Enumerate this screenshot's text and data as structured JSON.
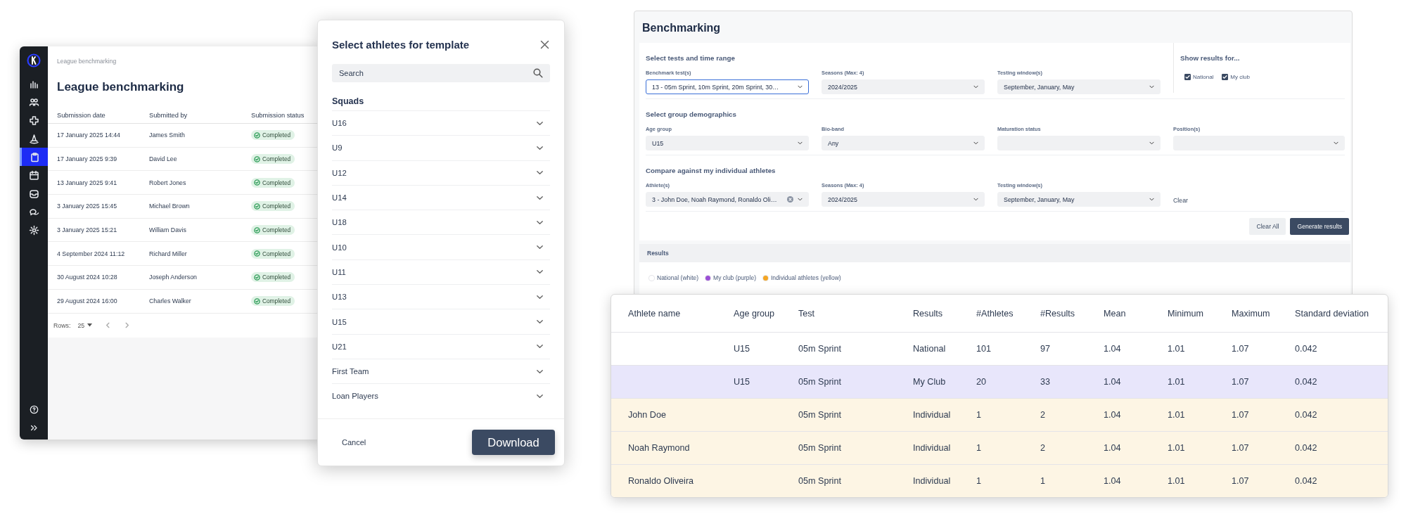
{
  "league_app": {
    "sidebar": {
      "items": [
        {
          "selected": false
        },
        {
          "selected": false
        },
        {
          "selected": false
        },
        {
          "selected": false
        },
        {
          "selected": true
        },
        {
          "selected": false
        },
        {
          "selected": false
        },
        {
          "selected": false
        },
        {
          "selected": false
        }
      ]
    },
    "breadcrumb": "League benchmarking",
    "title": "League benchmarking",
    "table": {
      "columns": [
        "Submission date",
        "Submitted by",
        "Submission status"
      ],
      "rows": [
        {
          "date": "17 January 2025 14:44",
          "by": "James Smith",
          "status": "Completed"
        },
        {
          "date": "17 January 2025 9:39",
          "by": "David Lee",
          "status": "Completed"
        },
        {
          "date": "13 January 2025 9:41",
          "by": "Robert Jones",
          "status": "Completed"
        },
        {
          "date": "3 January 2025 15:45",
          "by": "Michael Brown",
          "status": "Completed"
        },
        {
          "date": "3 January 2025 15:21",
          "by": "William Davis",
          "status": "Completed"
        },
        {
          "date": "4 September 2024 11:12",
          "by": "Richard Miller",
          "status": "Completed"
        },
        {
          "date": "30 August 2024 10:28",
          "by": "Joseph Anderson",
          "status": "Completed"
        },
        {
          "date": "29 August 2024 16:00",
          "by": "Charles Walker",
          "status": "Completed"
        }
      ]
    },
    "footer": {
      "rows_label": "Rows:",
      "rows_value": "25"
    }
  },
  "template_dialog": {
    "title": "Select athletes for template",
    "search": {
      "placeholder": "Search"
    },
    "section": "Squads",
    "squads": [
      {
        "label": "U16"
      },
      {
        "label": "U9"
      },
      {
        "label": "U12"
      },
      {
        "label": "U14"
      },
      {
        "label": "U18"
      },
      {
        "label": "U10"
      },
      {
        "label": "U11"
      },
      {
        "label": "U13"
      },
      {
        "label": "U15"
      },
      {
        "label": "U21"
      },
      {
        "label": "First Team"
      },
      {
        "label": "Loan Players"
      }
    ],
    "cancel": "Cancel",
    "download": "Download"
  },
  "benchmarking": {
    "title": "Benchmarking",
    "sections": [
      {
        "title": "Select tests and time range",
        "fields": [
          {
            "label": "Benchmark test(s)",
            "value": "13 - 05m Sprint, 10m Sprint, 20m Sprint, 30…",
            "focused": true,
            "clearable": false
          },
          {
            "label": "Seasons (Max: 4)",
            "value": "2024/2025",
            "focused": false,
            "clearable": false
          },
          {
            "label": "Testing window(s)",
            "value": "September, January, May",
            "focused": false,
            "clearable": false
          }
        ]
      },
      {
        "title": "Select group demographics",
        "fields": [
          {
            "label": "Age group",
            "value": "U15",
            "focused": false,
            "clearable": false
          },
          {
            "label": "Bio-band",
            "value": "Any",
            "focused": false,
            "clearable": false
          },
          {
            "label": "Maturation status",
            "focused": false,
            "clearable": false
          },
          {
            "label": "Position(s)",
            "focused": false,
            "clearable": false
          }
        ]
      },
      {
        "title": "Compare against my individual athletes",
        "fields": [
          {
            "label": "Athlete(s)",
            "value": "3 - John Doe, Noah Raymond, Ronaldo Oli…",
            "focused": false,
            "clearable": true
          },
          {
            "label": "Seasons (Max: 4)",
            "value": "2024/2025",
            "focused": false,
            "clearable": false
          },
          {
            "label": "Testing window(s)",
            "value": "September, January, May",
            "focused": false,
            "clearable": false
          }
        ]
      }
    ],
    "show_results": {
      "title": "Show results for...",
      "options": [
        {
          "label": "National",
          "checked": true
        },
        {
          "label": "My club",
          "checked": true
        }
      ]
    },
    "clear": "Clear",
    "clear_all": "Clear All",
    "generate": "Generate results",
    "results": {
      "title": "Results",
      "legend": [
        {
          "label": "National (white)",
          "color": "#ffffff"
        },
        {
          "label": "My club (purple)",
          "color": "#9b4fd6"
        },
        {
          "label": "Individual athletes (yellow)",
          "color": "#f5a623"
        }
      ]
    }
  },
  "results_table": {
    "columns": [
      "Athlete name",
      "Age group",
      "Test",
      "Results",
      "#Athletes",
      "#Results",
      "Mean",
      "Minimum",
      "Maximum",
      "Standard deviation"
    ],
    "rows": [
      {
        "kind": "national",
        "age_group": "U15",
        "test": "05m Sprint",
        "results": "National",
        "athletes": "101",
        "result_count": "97",
        "mean": "1.04",
        "minimum": "1.01",
        "maximum": "1.07",
        "std": "0.042"
      },
      {
        "kind": "club",
        "age_group": "U15",
        "test": "05m Sprint",
        "results": "My Club",
        "athletes": "20",
        "result_count": "33",
        "mean": "1.04",
        "minimum": "1.01",
        "maximum": "1.07",
        "std": "0.042"
      },
      {
        "kind": "individual",
        "athlete": "John Doe",
        "test": "05m Sprint",
        "results": "Individual",
        "athletes": "1",
        "result_count": "2",
        "mean": "1.04",
        "minimum": "1.01",
        "maximum": "1.07",
        "std": "0.042"
      },
      {
        "kind": "individual",
        "athlete": "Noah Raymond",
        "test": "05m Sprint",
        "results": "Individual",
        "athletes": "1",
        "result_count": "2",
        "mean": "1.04",
        "minimum": "1.01",
        "maximum": "1.07",
        "std": "0.042"
      },
      {
        "kind": "individual",
        "athlete": "Ronaldo Oliveira",
        "test": "05m Sprint",
        "results": "Individual",
        "athletes": "1",
        "result_count": "1",
        "mean": "1.04",
        "minimum": "1.01",
        "maximum": "1.07",
        "std": "0.042"
      }
    ]
  }
}
